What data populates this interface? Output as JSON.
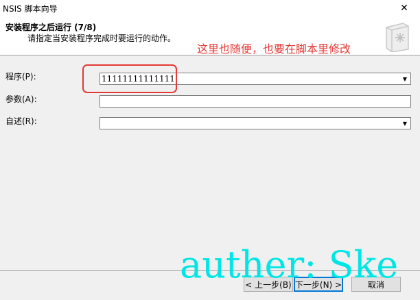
{
  "window": {
    "title": "NSIS 脚本向导",
    "close_glyph": "✕"
  },
  "header": {
    "title": "安装程序之后运行 (7/8)",
    "subtitle": "请指定当安装程序完成时要运行的动作。"
  },
  "annotation": "这里也随便，也要在脚本里修改",
  "fields": {
    "program": {
      "label": "程序(P):",
      "value": "11111111111111"
    },
    "params": {
      "label": "参数(A):",
      "value": ""
    },
    "description": {
      "label": "自述(R):",
      "value": ""
    }
  },
  "buttons": {
    "back": "< 上一步(B)",
    "next": "下一步(N) >",
    "cancel": "取消"
  },
  "watermark": "auther: Ske",
  "icons": {
    "header": "wizard-book-icon",
    "dropdown": "chevron-down-icon"
  }
}
